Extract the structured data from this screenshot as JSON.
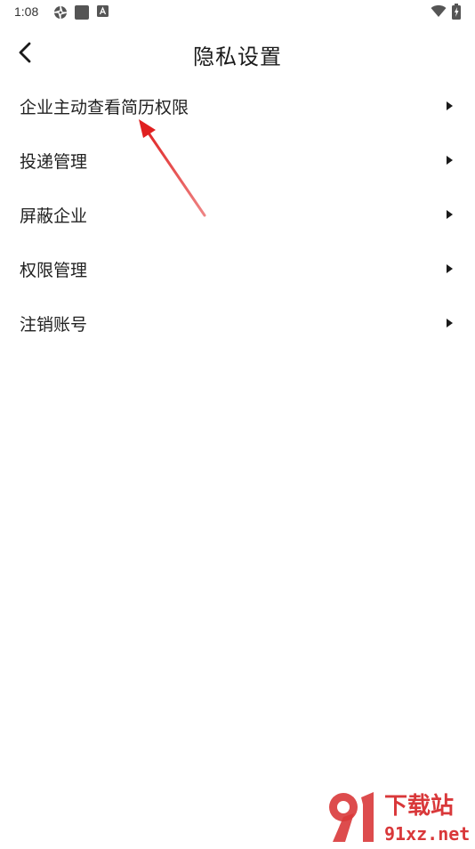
{
  "status_bar": {
    "time": "1:08",
    "icons": [
      "aperture-icon",
      "square-icon",
      "a-badge-icon",
      "wifi-icon",
      "battery-charging-icon"
    ]
  },
  "header": {
    "title": "隐私设置",
    "back_icon": "chevron-left-icon"
  },
  "menu": {
    "items": [
      {
        "label": "企业主动查看简历权限",
        "icon": "caret-right-icon"
      },
      {
        "label": "投递管理",
        "icon": "caret-right-icon"
      },
      {
        "label": "屏蔽企业",
        "icon": "caret-right-icon"
      },
      {
        "label": "权限管理",
        "icon": "caret-right-icon"
      },
      {
        "label": "注销账号",
        "icon": "caret-right-icon"
      }
    ]
  },
  "annotation": {
    "arrow_color": "#e02020"
  },
  "watermark": {
    "brand_text": "下载站",
    "domain_text": "91xz.net",
    "color": "#d9383a"
  }
}
